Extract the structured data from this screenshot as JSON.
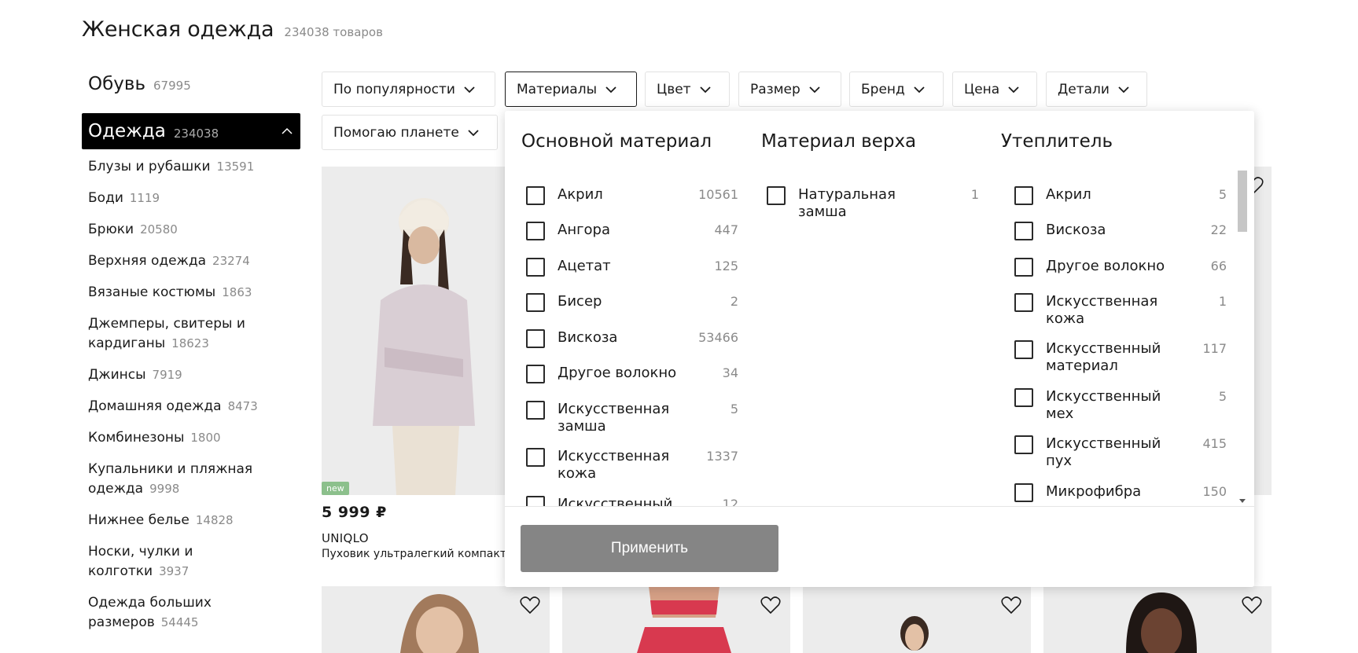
{
  "page": {
    "title": "Женская одежда",
    "count": "234038 товаров"
  },
  "sidebar": {
    "top": {
      "label": "Обувь",
      "count": "67995"
    },
    "active": {
      "label": "Одежда",
      "count": "234038"
    },
    "items": [
      {
        "label": "Блузы и рубашки",
        "count": "13591"
      },
      {
        "label": "Боди",
        "count": "1119"
      },
      {
        "label": "Брюки",
        "count": "20580"
      },
      {
        "label": "Верхняя одежда",
        "count": "23274"
      },
      {
        "label": "Вязаные костюмы",
        "count": "1863"
      },
      {
        "label": "Джемперы, свитеры и кардиганы",
        "count": "18623"
      },
      {
        "label": "Джинсы",
        "count": "7919"
      },
      {
        "label": "Домашняя одежда",
        "count": "8473"
      },
      {
        "label": "Комбинезоны",
        "count": "1800"
      },
      {
        "label": "Купальники и пляжная одежда",
        "count": "9998"
      },
      {
        "label": "Нижнее белье",
        "count": "14828"
      },
      {
        "label": "Носки, чулки и колготки",
        "count": "3937"
      },
      {
        "label": "Одежда больших размеров",
        "count": "54445"
      }
    ]
  },
  "filters": [
    "По популярности",
    "Материалы",
    "Цвет",
    "Размер",
    "Бренд",
    "Цена",
    "Детали",
    "Помогаю планете"
  ],
  "product": {
    "badge": "new",
    "price": "5 999 ₽",
    "brand": "UNIQLO",
    "name": "Пуховик ультралегкий компактный"
  },
  "dropdown": {
    "col1": {
      "title": "Основной материал",
      "options": [
        {
          "label": "Акрил",
          "count": "10561"
        },
        {
          "label": "Ангора",
          "count": "447"
        },
        {
          "label": "Ацетат",
          "count": "125"
        },
        {
          "label": "Бисер",
          "count": "2"
        },
        {
          "label": "Вискоза",
          "count": "53466"
        },
        {
          "label": "Другое волокно",
          "count": "34"
        },
        {
          "label": "Искусственная замша",
          "count": "5"
        },
        {
          "label": "Искусственная кожа",
          "count": "1337"
        },
        {
          "label": "Искусственный",
          "count": "12"
        }
      ]
    },
    "col2": {
      "title": "Материал верха",
      "options": [
        {
          "label": "Натуральная замша",
          "count": "1"
        }
      ]
    },
    "col3": {
      "title": "Утеплитель",
      "options": [
        {
          "label": "Акрил",
          "count": "5"
        },
        {
          "label": "Вискоза",
          "count": "22"
        },
        {
          "label": "Другое волокно",
          "count": "66"
        },
        {
          "label": "Искусственная кожа",
          "count": "1"
        },
        {
          "label": "Искусственный материал",
          "count": "117"
        },
        {
          "label": "Искусственный мех",
          "count": "5"
        },
        {
          "label": "Искусственный пух",
          "count": "415"
        },
        {
          "label": "Микрофибра",
          "count": "150"
        }
      ]
    },
    "apply_label": "Применить"
  }
}
